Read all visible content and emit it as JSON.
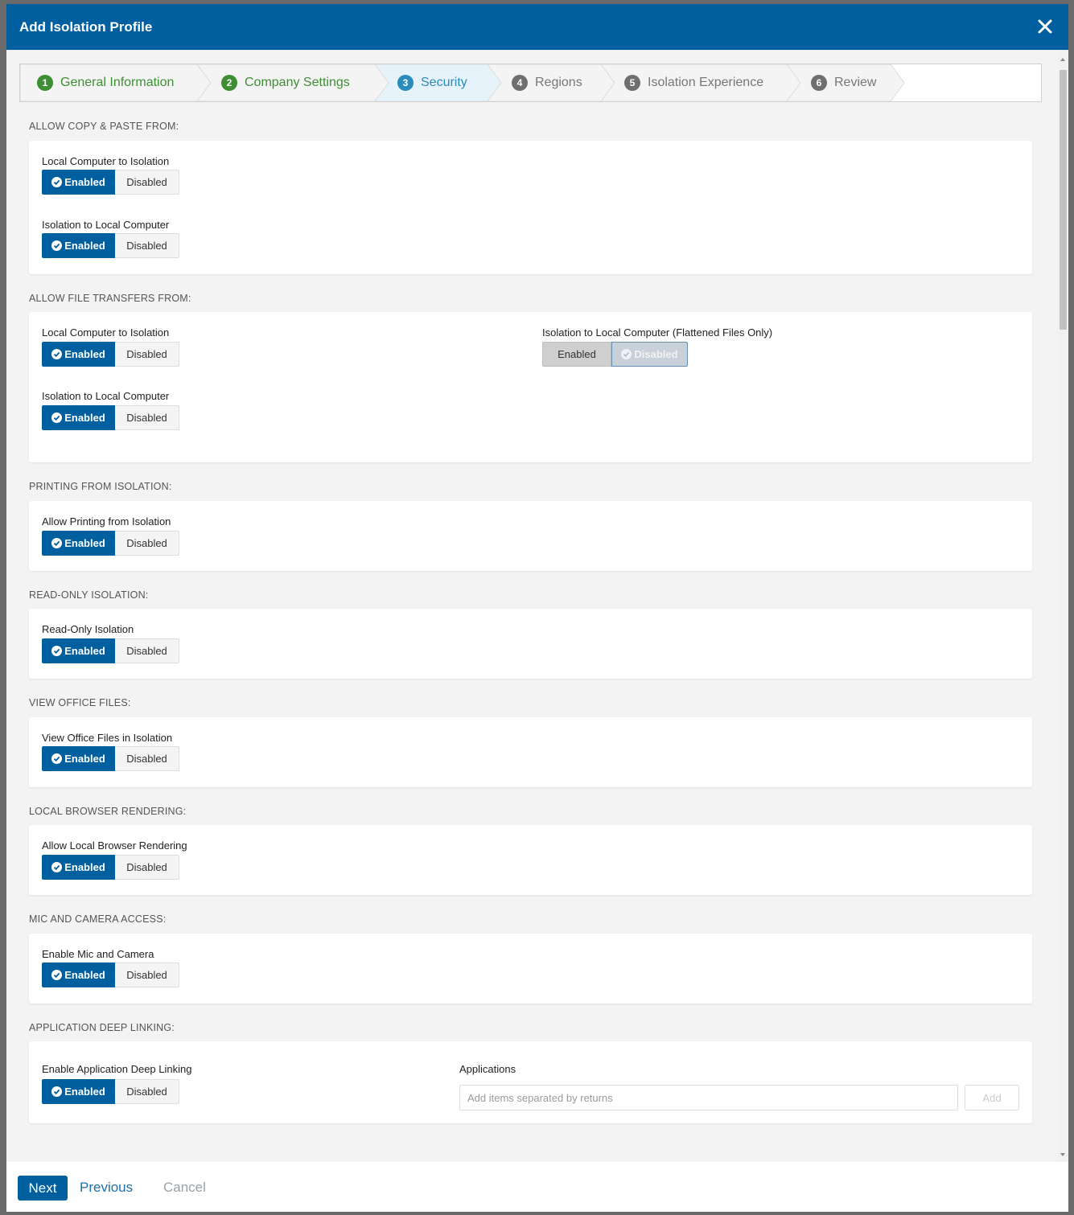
{
  "modal": {
    "title": "Add Isolation Profile"
  },
  "wizard": {
    "steps": [
      {
        "num": "1",
        "label": "General Information"
      },
      {
        "num": "2",
        "label": "Company Settings"
      },
      {
        "num": "3",
        "label": "Security"
      },
      {
        "num": "4",
        "label": "Regions"
      },
      {
        "num": "5",
        "label": "Isolation Experience"
      },
      {
        "num": "6",
        "label": "Review"
      }
    ]
  },
  "labels": {
    "enabled": "Enabled",
    "disabled": "Disabled"
  },
  "sections": {
    "copy_paste": {
      "title": "ALLOW COPY & PASTE FROM:",
      "local_to_isolation": "Local Computer to Isolation",
      "isolation_to_local": "Isolation to Local Computer"
    },
    "file_transfers": {
      "title": "ALLOW FILE TRANSFERS FROM:",
      "local_to_isolation": "Local Computer to Isolation",
      "isolation_to_local": "Isolation to Local Computer",
      "flattened": "Isolation to Local Computer (Flattened Files Only)"
    },
    "printing": {
      "title": "PRINTING FROM ISOLATION:",
      "allow": "Allow Printing from Isolation"
    },
    "read_only": {
      "title": "READ-ONLY ISOLATION:",
      "label": "Read-Only Isolation"
    },
    "office_files": {
      "title": "VIEW OFFICE FILES:",
      "label": "View Office Files in Isolation"
    },
    "local_rendering": {
      "title": "LOCAL BROWSER RENDERING:",
      "label": "Allow Local Browser Rendering"
    },
    "mic_camera": {
      "title": "MIC AND CAMERA ACCESS:",
      "label": "Enable Mic and Camera"
    },
    "deep_linking": {
      "title": "APPLICATION DEEP LINKING:",
      "label": "Enable Application Deep Linking",
      "apps_label": "Applications",
      "apps_placeholder": "Add items separated by returns",
      "add_label": "Add"
    }
  },
  "footer": {
    "next": "Next",
    "previous": "Previous",
    "cancel": "Cancel"
  },
  "colors": {
    "primary": "#005f9e",
    "step_done": "#3e8f34",
    "step_active": "#2b8bbb",
    "step_todo": "#6f6f6f"
  }
}
